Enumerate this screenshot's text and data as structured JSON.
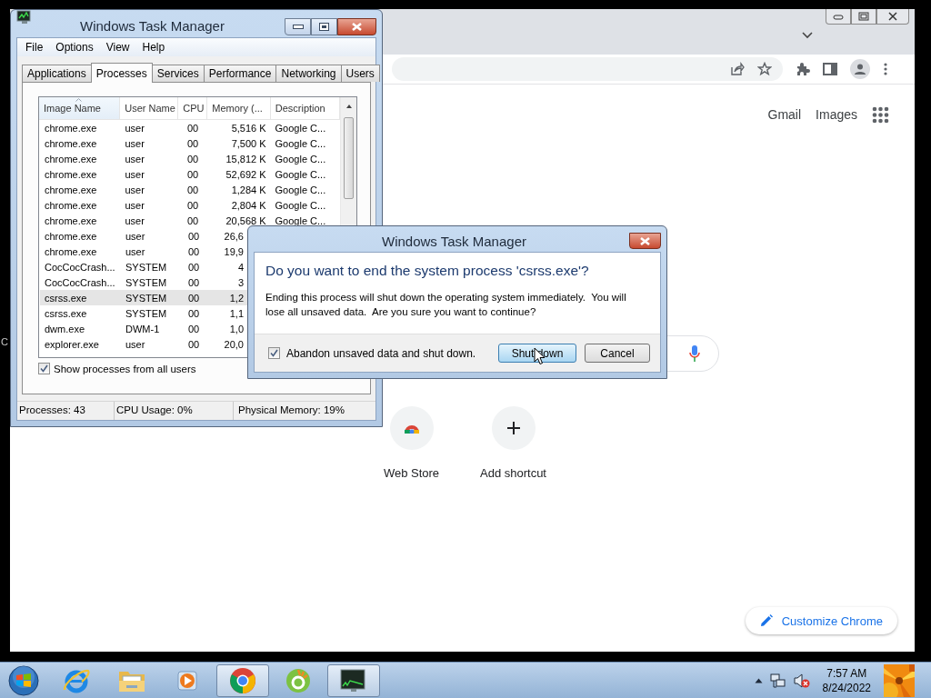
{
  "edge_text": "C",
  "browser": {
    "header_links": [
      "Gmail",
      "Images"
    ],
    "shortcuts": [
      {
        "label": "Web Store",
        "kind": "webstore"
      },
      {
        "label": "Add shortcut",
        "kind": "add"
      }
    ],
    "customize_button": "Customize Chrome"
  },
  "task_manager": {
    "title": "Windows Task Manager",
    "menu": [
      "File",
      "Options",
      "View",
      "Help"
    ],
    "tabs": [
      {
        "label": "Applications",
        "selected": false
      },
      {
        "label": "Processes",
        "selected": true
      },
      {
        "label": "Services",
        "selected": false
      },
      {
        "label": "Performance",
        "selected": false
      },
      {
        "label": "Networking",
        "selected": false
      },
      {
        "label": "Users",
        "selected": false
      }
    ],
    "columns": [
      {
        "label": "Image Name",
        "sorted": true
      },
      {
        "label": "User Name",
        "sorted": false
      },
      {
        "label": "CPU",
        "sorted": false
      },
      {
        "label": "Memory (...",
        "sorted": false
      },
      {
        "label": "Description",
        "sorted": false
      }
    ],
    "rows": [
      {
        "cells": [
          "chrome.exe",
          "user",
          "00",
          "5,516 K",
          "Google C..."
        ],
        "selected": false,
        "memory_cut": false
      },
      {
        "cells": [
          "chrome.exe",
          "user",
          "00",
          "7,500 K",
          "Google C..."
        ],
        "selected": false,
        "memory_cut": false
      },
      {
        "cells": [
          "chrome.exe",
          "user",
          "00",
          "15,812 K",
          "Google C..."
        ],
        "selected": false,
        "memory_cut": false
      },
      {
        "cells": [
          "chrome.exe",
          "user",
          "00",
          "52,692 K",
          "Google C..."
        ],
        "selected": false,
        "memory_cut": false
      },
      {
        "cells": [
          "chrome.exe",
          "user",
          "00",
          "1,284 K",
          "Google C..."
        ],
        "selected": false,
        "memory_cut": false
      },
      {
        "cells": [
          "chrome.exe",
          "user",
          "00",
          "2,804 K",
          "Google C..."
        ],
        "selected": false,
        "memory_cut": false
      },
      {
        "cells": [
          "chrome.exe",
          "user",
          "00",
          "20,568 K",
          "Google C..."
        ],
        "selected": false,
        "memory_cut": false
      },
      {
        "cells": [
          "chrome.exe",
          "user",
          "00",
          "26,6"
        ],
        "selected": false,
        "memory_cut": true
      },
      {
        "cells": [
          "chrome.exe",
          "user",
          "00",
          "19,9"
        ],
        "selected": false,
        "memory_cut": true
      },
      {
        "cells": [
          "CocCocCrash...",
          "SYSTEM",
          "00",
          "4"
        ],
        "selected": false,
        "memory_cut": true
      },
      {
        "cells": [
          "CocCocCrash...",
          "SYSTEM",
          "00",
          "3"
        ],
        "selected": false,
        "memory_cut": true
      },
      {
        "cells": [
          "csrss.exe",
          "SYSTEM",
          "00",
          "1,2"
        ],
        "selected": true,
        "memory_cut": true
      },
      {
        "cells": [
          "csrss.exe",
          "SYSTEM",
          "00",
          "1,1"
        ],
        "selected": false,
        "memory_cut": true
      },
      {
        "cells": [
          "dwm.exe",
          "DWM-1",
          "00",
          "1,0"
        ],
        "selected": false,
        "memory_cut": true
      },
      {
        "cells": [
          "explorer.exe",
          "user",
          "00",
          "20,0"
        ],
        "selected": false,
        "memory_cut": true
      }
    ],
    "show_all_users": {
      "label": "Show processes from all users",
      "checked": true
    },
    "status_bar": [
      "Processes: 43",
      "CPU Usage: 0%",
      "Physical Memory: 19%"
    ]
  },
  "dialog": {
    "title": "Windows Task Manager",
    "heading": "Do you want to end the system process 'csrss.exe'?",
    "message": "Ending this process will shut down the operating system immediately.  You will lose all unsaved data.  Are you sure you want to continue?",
    "checkbox": {
      "label": "Abandon unsaved data and shut down.",
      "checked": true
    },
    "buttons": [
      {
        "label": "Shut down",
        "default": true
      },
      {
        "label": "Cancel",
        "default": false
      }
    ]
  },
  "taskbar": {
    "apps": [
      {
        "kind": "start",
        "active": false
      },
      {
        "kind": "ie",
        "active": false
      },
      {
        "kind": "folder",
        "active": false
      },
      {
        "kind": "media",
        "active": false
      },
      {
        "kind": "chrome",
        "active": true
      },
      {
        "kind": "coccoc",
        "active": false
      },
      {
        "kind": "taskmgr",
        "active": true
      }
    ],
    "clock": {
      "time": "7:57 AM",
      "date": "8/24/2022"
    }
  }
}
